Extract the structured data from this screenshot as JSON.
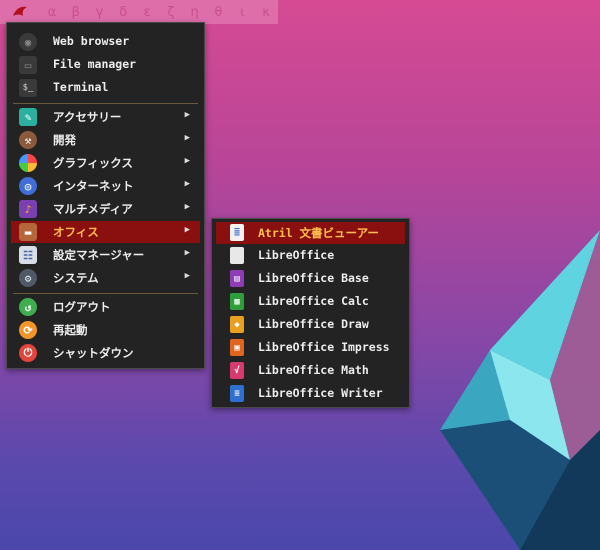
{
  "taskbar": {
    "logo_icon": "bird-logo-icon",
    "workspaces": [
      "α",
      "β",
      "γ",
      "δ",
      "ε",
      "ζ",
      "η",
      "θ",
      "ι",
      "κ"
    ]
  },
  "main_menu": {
    "pinned": [
      {
        "label": "Web browser",
        "icon": "compass-icon"
      },
      {
        "label": "File manager",
        "icon": "folder-icon"
      },
      {
        "label": "Terminal",
        "icon": "terminal-icon"
      }
    ],
    "categories": [
      {
        "label": "アクセサリー",
        "icon": "accessories-icon",
        "arrow": "▶"
      },
      {
        "label": "開発",
        "icon": "hammer-icon",
        "arrow": "▶"
      },
      {
        "label": "グラフィックス",
        "icon": "graphics-icon",
        "arrow": "▶"
      },
      {
        "label": "インターネット",
        "icon": "globe-icon",
        "arrow": "▶"
      },
      {
        "label": "マルチメディア",
        "icon": "multimedia-icon",
        "arrow": "▶"
      },
      {
        "label": "オフィス",
        "icon": "briefcase-icon",
        "arrow": "▶",
        "active": true
      },
      {
        "label": "設定マネージャー",
        "icon": "settings-manager-icon",
        "arrow": "▶"
      },
      {
        "label": "システム",
        "icon": "gear-icon",
        "arrow": "▶"
      }
    ],
    "session": [
      {
        "label": "ログアウト",
        "icon": "logout-icon"
      },
      {
        "label": "再起動",
        "icon": "restart-icon"
      },
      {
        "label": "シャットダウン",
        "icon": "power-icon"
      }
    ]
  },
  "office_menu": {
    "items": [
      {
        "label": "Atril 文書ビューアー",
        "icon": "document-viewer-icon",
        "active": true
      },
      {
        "label": "LibreOffice",
        "icon": "libreoffice-icon"
      },
      {
        "label": "LibreOffice Base",
        "icon": "libreoffice-base-icon"
      },
      {
        "label": "LibreOffice Calc",
        "icon": "libreoffice-calc-icon"
      },
      {
        "label": "LibreOffice Draw",
        "icon": "libreoffice-draw-icon"
      },
      {
        "label": "LibreOffice Impress",
        "icon": "libreoffice-impress-icon"
      },
      {
        "label": "LibreOffice Math",
        "icon": "libreoffice-math-icon"
      },
      {
        "label": "LibreOffice Writer",
        "icon": "libreoffice-writer-icon"
      }
    ]
  },
  "colors": {
    "menu_bg": "#232323",
    "active_bg": "#8a0f0f",
    "active_text": "#ffc04d",
    "text": "#ededed"
  }
}
